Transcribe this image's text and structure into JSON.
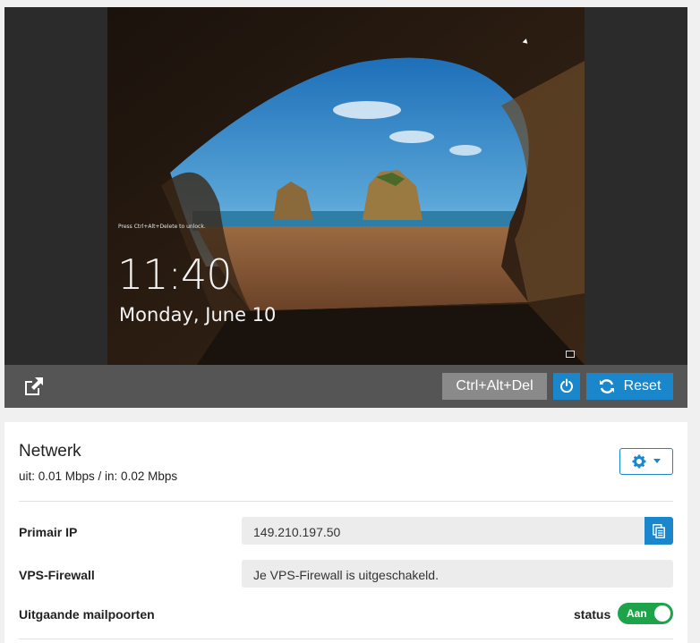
{
  "console": {
    "lock_hint": "Press Ctrl+Alt+Delete to unlock.",
    "time": "11:40",
    "date": "Monday, June 10",
    "ctrl_alt_del_label": "Ctrl+Alt+Del",
    "reset_label": "Reset",
    "icons": {
      "popout": "external-link-icon",
      "power": "power-icon",
      "reset": "refresh-icon",
      "network": "network-icon"
    }
  },
  "network": {
    "title": "Netwerk",
    "traffic": "uit: 0.01 Mbps / in: 0.02 Mbps",
    "settings_icon": "gear-icon",
    "rows": {
      "primary_ip": {
        "label": "Primair IP",
        "value": "149.210.197.50"
      },
      "firewall": {
        "label": "VPS-Firewall",
        "value": "Je VPS-Firewall is uitgeschakeld."
      },
      "mail_ports": {
        "label": "Uitgaande mailpoorten",
        "status_label": "status",
        "toggle_text": "Aan"
      }
    }
  },
  "colors": {
    "accent": "#1a86cc",
    "toggle_on": "#1fa34a",
    "console_bar": "#555555",
    "field_bg": "#ececec"
  }
}
